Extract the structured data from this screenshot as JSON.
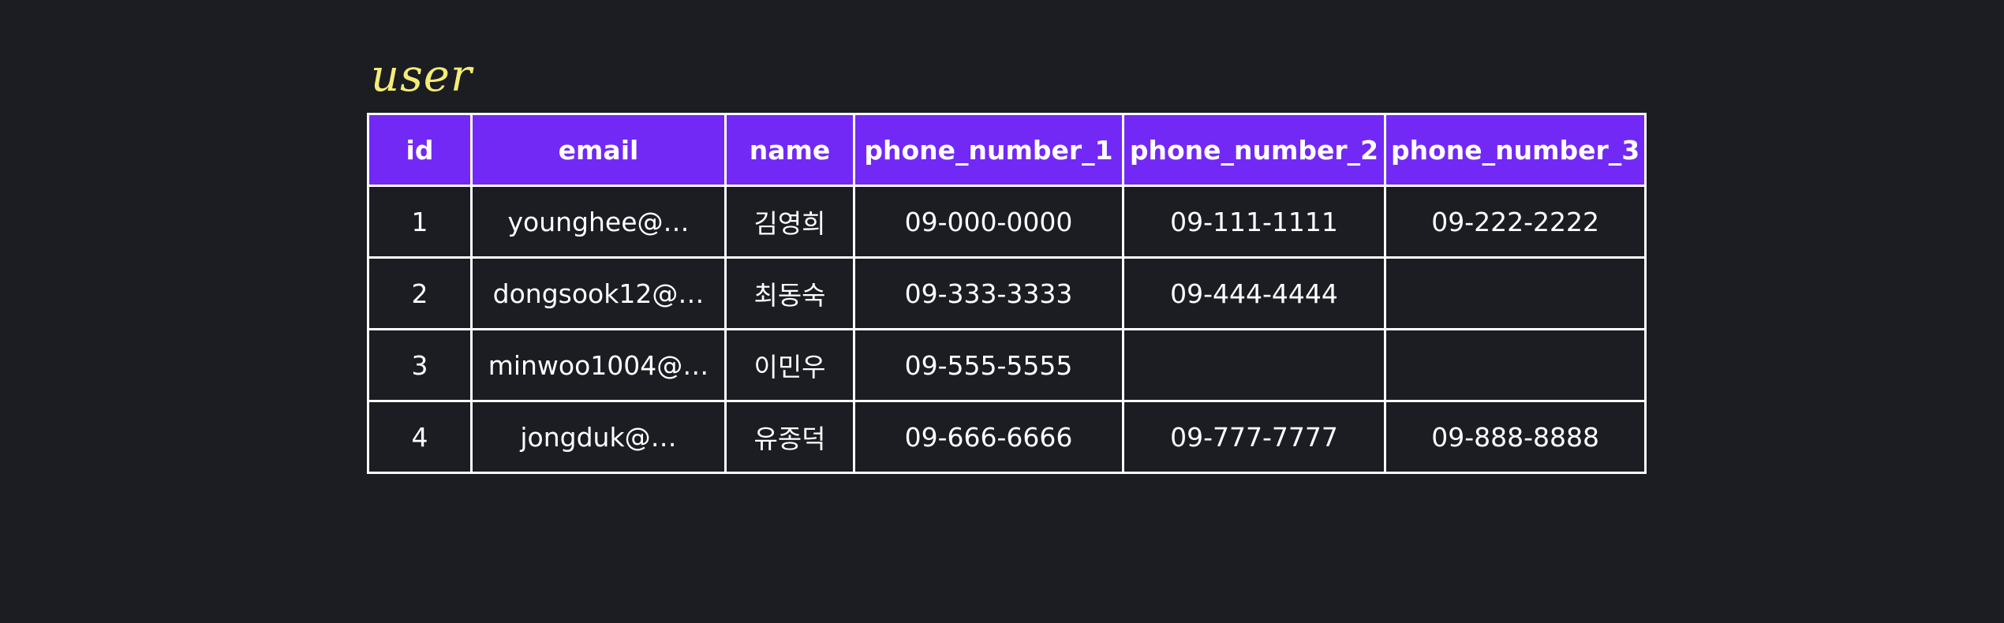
{
  "table": {
    "title": "user",
    "columns": [
      "id",
      "email",
      "name",
      "phone_number_1",
      "phone_number_2",
      "phone_number_3"
    ],
    "rows": [
      [
        "1",
        "younghee@…",
        "김영희",
        "09-000-0000",
        "09-111-1111",
        "09-222-2222"
      ],
      [
        "2",
        "dongsook12@…",
        "최동숙",
        "09-333-3333",
        "09-444-4444",
        ""
      ],
      [
        "3",
        "minwoo1004@…",
        "이민우",
        "09-555-5555",
        "",
        ""
      ],
      [
        "4",
        "jongduk@…",
        "유종덕",
        "09-666-6666",
        "09-777-7777",
        "09-888-8888"
      ]
    ]
  },
  "colors": {
    "background": "#1b1d22",
    "header_fill": "#7229f5",
    "title_text": "#f3ec78",
    "cell_text": "#ffffff",
    "border": "#ffffff"
  }
}
